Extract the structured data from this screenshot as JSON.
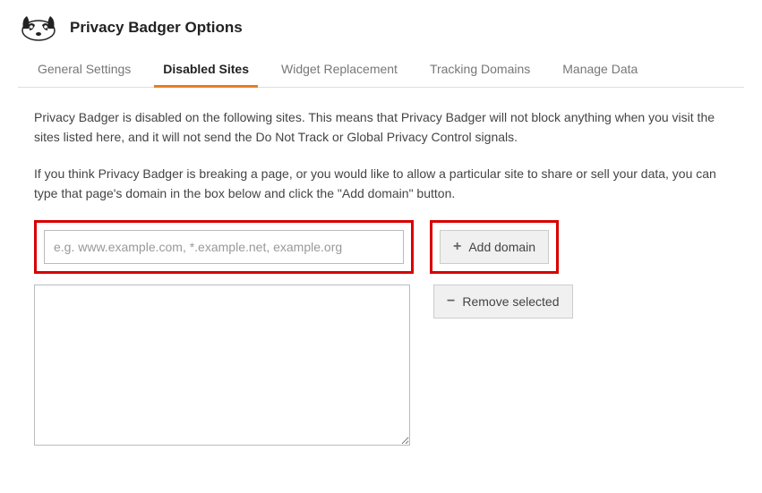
{
  "header": {
    "title": "Privacy Badger Options"
  },
  "tabs": [
    {
      "label": "General Settings"
    },
    {
      "label": "Disabled Sites"
    },
    {
      "label": "Widget Replacement"
    },
    {
      "label": "Tracking Domains"
    },
    {
      "label": "Manage Data"
    }
  ],
  "active_tab_index": 1,
  "content": {
    "para1": "Privacy Badger is disabled on the following sites. This means that Privacy Badger will not block anything when you visit the sites listed here, and it will not send the Do Not Track or Global Privacy Control signals.",
    "para2": "If you think Privacy Badger is breaking a page, or you would like to allow a particular site to share or sell your data, you can type that page's domain in the box below and click the \"Add domain\" button."
  },
  "domain_input": {
    "value": "",
    "placeholder": "e.g. www.example.com, *.example.net, example.org"
  },
  "buttons": {
    "add_symbol": "+",
    "add_label": "Add domain",
    "remove_symbol": "−",
    "remove_label": "Remove selected"
  },
  "disabled_sites": []
}
